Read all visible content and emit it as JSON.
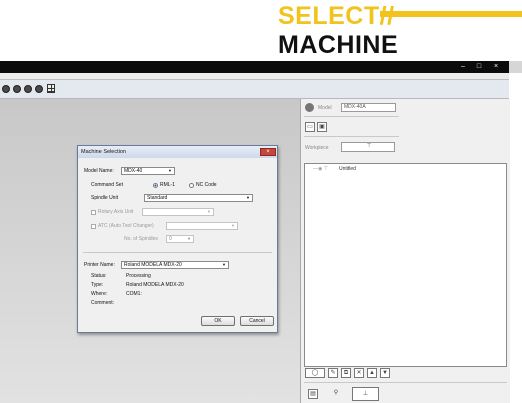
{
  "banner": {
    "line1": "SELECT//",
    "line2": "MACHINE"
  },
  "window": {
    "controls": [
      "–",
      "□",
      "×"
    ]
  },
  "toolbar": {
    "icons": [
      "sphere-icon",
      "sphere-icon",
      "sphere-icon",
      "sphere-icon",
      "grid-icon"
    ]
  },
  "panel": {
    "model_label": "Model",
    "model_value": "MDX-40A",
    "workpiece_label": "Workpiece",
    "tree_item": "Untitled"
  },
  "dialog": {
    "title": "Machine Selection",
    "close": "×",
    "model_name_label": "Model Name:",
    "model_name_value": "MDX-40",
    "command_set_label": "Command Set",
    "command_set_options": [
      "RML-1",
      "NC Code"
    ],
    "command_set_selected": "RML-1",
    "spindle_unit_label": "Spindle Unit",
    "spindle_unit_value": "Standard",
    "rotary_axis_label": "Rotary Axis Unit",
    "atc_label": "ATC (Auto Tool Changer)",
    "no_of_spindles_label": "No. of Spindles",
    "no_of_spindles_value": "0",
    "printer_name_label": "Printer Name:",
    "printer_name_value": "Roland MODELA MDX-20",
    "status_label": "Status:",
    "status_value": "Processing",
    "type_label": "Type:",
    "type_value": "Roland MODELA MDX-20",
    "where_label": "Where:",
    "where_value": "COM1:",
    "comment_label": "Comment:",
    "comment_value": "",
    "ok": "OK",
    "cancel": "Cancel"
  }
}
